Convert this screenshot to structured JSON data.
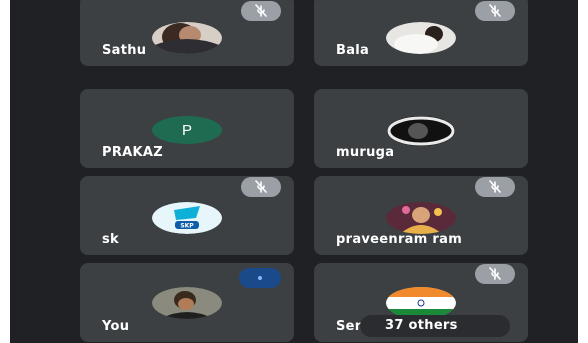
{
  "participants": [
    {
      "name": "Sathu",
      "muted": true,
      "avatar": "photo-avatar"
    },
    {
      "name": "Bala",
      "muted": true,
      "avatar": "photo-avatar"
    },
    {
      "name": "PRAKAZ",
      "muted": false,
      "avatar": "letter-avatar",
      "initial": "P"
    },
    {
      "name": "muruga",
      "muted": false,
      "avatar": "photo-avatar"
    },
    {
      "name": "sk",
      "muted": true,
      "avatar": "logo-avatar",
      "logo_text": "SKP"
    },
    {
      "name": "praveenram ram",
      "muted": true,
      "avatar": "photo-avatar"
    },
    {
      "name": "You",
      "muted": false,
      "avatar": "photo-avatar",
      "speaking_indicator": true
    },
    {
      "name": "Sen",
      "muted": true,
      "avatar": "flag-avatar",
      "others_label": "37 others"
    }
  ],
  "colors": {
    "background": "#202124",
    "tile": "#3c4043",
    "mute_badge": "#9aa0a6",
    "letter_avatar": "#1e6b52",
    "speaking_badge": "#1a4a8a"
  },
  "icons": {
    "mute": "mic-off-icon"
  }
}
